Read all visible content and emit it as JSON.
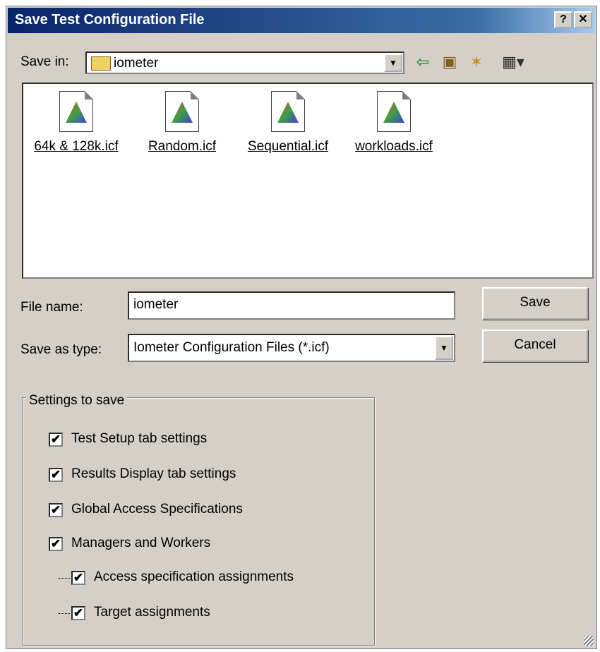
{
  "window": {
    "title": "Save Test Configuration File",
    "help_glyph": "?",
    "close_glyph": "✕"
  },
  "toolbar": {
    "save_in_label": "Save in:",
    "save_in_value": "iometer",
    "back_glyph": "⇦",
    "up_glyph": "▣",
    "newfolder_glyph": "✶",
    "view_glyph": "▦▾"
  },
  "files": [
    {
      "name": "64k & 128k.icf",
      "icon": "icf-file-icon"
    },
    {
      "name": "Random.icf",
      "icon": "icf-file-icon"
    },
    {
      "name": "Sequential.icf",
      "icon": "icf-file-icon"
    },
    {
      "name": "workloads.icf",
      "icon": "icf-file-icon"
    }
  ],
  "form": {
    "filename_label": "File name:",
    "filename_value": "iometer",
    "type_label": "Save as type:",
    "type_value": "Iometer Configuration Files (*.icf)",
    "save_button": "Save",
    "cancel_button": "Cancel",
    "dropdown_glyph": "▼"
  },
  "settings": {
    "legend": "Settings to save",
    "items": [
      {
        "label": "Test Setup tab settings",
        "checked": "✔"
      },
      {
        "label": "Results Display tab settings",
        "checked": "✔"
      },
      {
        "label": "Global Access Specifications",
        "checked": "✔"
      },
      {
        "label": "Managers and Workers",
        "checked": "✔"
      },
      {
        "label": "Access specification assignments",
        "checked": "✔"
      },
      {
        "label": "Target assignments",
        "checked": "✔"
      }
    ]
  },
  "colors": {
    "title_bar": "#0a246a",
    "dialog_face": "#d4d0c8"
  }
}
